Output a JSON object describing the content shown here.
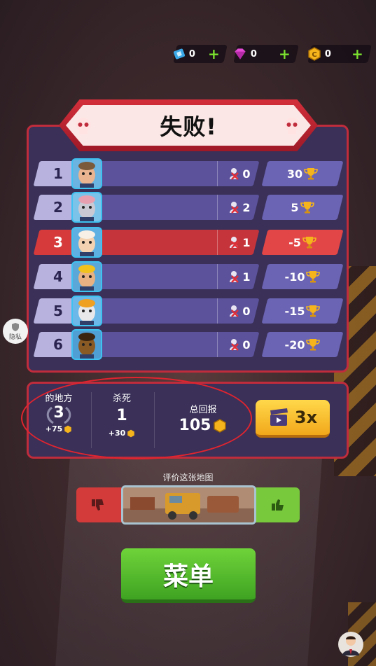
{
  "currencies": [
    {
      "icon": "ticket-icon",
      "value": "0",
      "plus": "+"
    },
    {
      "icon": "gem-icon",
      "value": "0",
      "plus": "+"
    },
    {
      "icon": "coin-icon",
      "value": "0",
      "plus": "+"
    }
  ],
  "title": "失败!",
  "leaderboard": [
    {
      "rank": "1",
      "kills": "0",
      "trophies": "30",
      "me": false,
      "avatar": "grandpa-avatar"
    },
    {
      "rank": "2",
      "kills": "2",
      "trophies": "5",
      "me": false,
      "avatar": "mouse-avatar"
    },
    {
      "rank": "3",
      "kills": "1",
      "trophies": "-5",
      "me": true,
      "avatar": "chef-avatar"
    },
    {
      "rank": "4",
      "kills": "1",
      "trophies": "-10",
      "me": false,
      "avatar": "worker-avatar"
    },
    {
      "rank": "5",
      "kills": "0",
      "trophies": "-15",
      "me": false,
      "avatar": "chicken-avatar"
    },
    {
      "rank": "6",
      "kills": "0",
      "trophies": "-20",
      "me": false,
      "avatar": "ball-avatar"
    }
  ],
  "stats": {
    "place_label": "的地方",
    "place_value": "3",
    "place_bonus": "+75",
    "kills_label": "杀死",
    "kills_value": "1",
    "kills_bonus": "+30",
    "total_label": "总回报",
    "total_value": "105"
  },
  "video_multiplier": "3x",
  "rate_label": "评价这张地图",
  "menu_label": "菜单",
  "privacy_label": "隐私",
  "colors": {
    "accent_red": "#c02c3b",
    "panel": "#3a3058",
    "green": "#6fd33a",
    "gold": "#ffd84a"
  }
}
